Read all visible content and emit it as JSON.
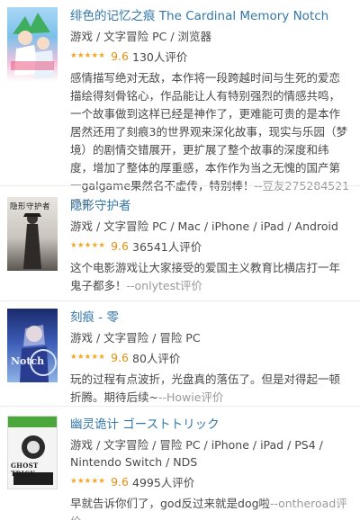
{
  "items": [
    {
      "title": "绯色的记忆之痕 The Cardinal Memory Notch",
      "meta": "游戏 / 文字冒险 PC / 浏览器",
      "stars": "★★★★★",
      "score": "9.6",
      "count": "130人评价",
      "comment": "感情描写绝对无敌，本作将一段跨越时间与生死的爱恋描绘得刻骨铭心，作品能让人有特别强烈的情感共鸣，一个故事做到这样已经是神作了，更难能可贵的是本作居然还用了刻痕3的世界观来深化故事，现实与乐园（梦境）的剧情交错展开，更扩展了整个故事的深度和纬度，增加了整体的厚重感，本作作为当之无愧的国产第一galgame果然名不虚传，特别棒！",
      "by": "--豆友275284521评价",
      "cover_text": ""
    },
    {
      "title": "隐形守护者",
      "meta": "游戏 / 文字冒险 PC / Mac / iPhone / iPad / Android",
      "stars": "★★★★★",
      "score": "9.6",
      "count": "36541人评价",
      "comment": "这个电影游戏让大家接受的爱国主义教育比横店打一年鬼子都多！",
      "by": "--onlytest评价",
      "cover_text": "隐形守护者"
    },
    {
      "title": "刻痕 - 零",
      "meta": "游戏 / 文字冒险 / 冒险 PC",
      "stars": "★★★★★",
      "score": "9.6",
      "count": "80人评价",
      "comment": "玩的过程有点波折，光盘真的落伍了。但是对得起一顿折腾。期待后续~",
      "by": "--Howie评价",
      "cover_text": "Notch"
    },
    {
      "title": "幽灵诡计 ゴーストトリック",
      "meta": "游戏 / 文字冒险 / 冒险 PC / iPhone / iPad / PS4 / Nintendo Switch / NDS",
      "stars": "★★★★★",
      "score": "9.6",
      "count": "4995人评价",
      "comment": "早就告诉你们了，god反过来就是dog啦",
      "by": "--ontheroad评价",
      "cover_text": "GHOST TRICK"
    }
  ],
  "colors": {
    "link": "#3377aa",
    "star": "#f5a623",
    "score": "#e09015",
    "text": "#494949",
    "muted": "#999999"
  }
}
